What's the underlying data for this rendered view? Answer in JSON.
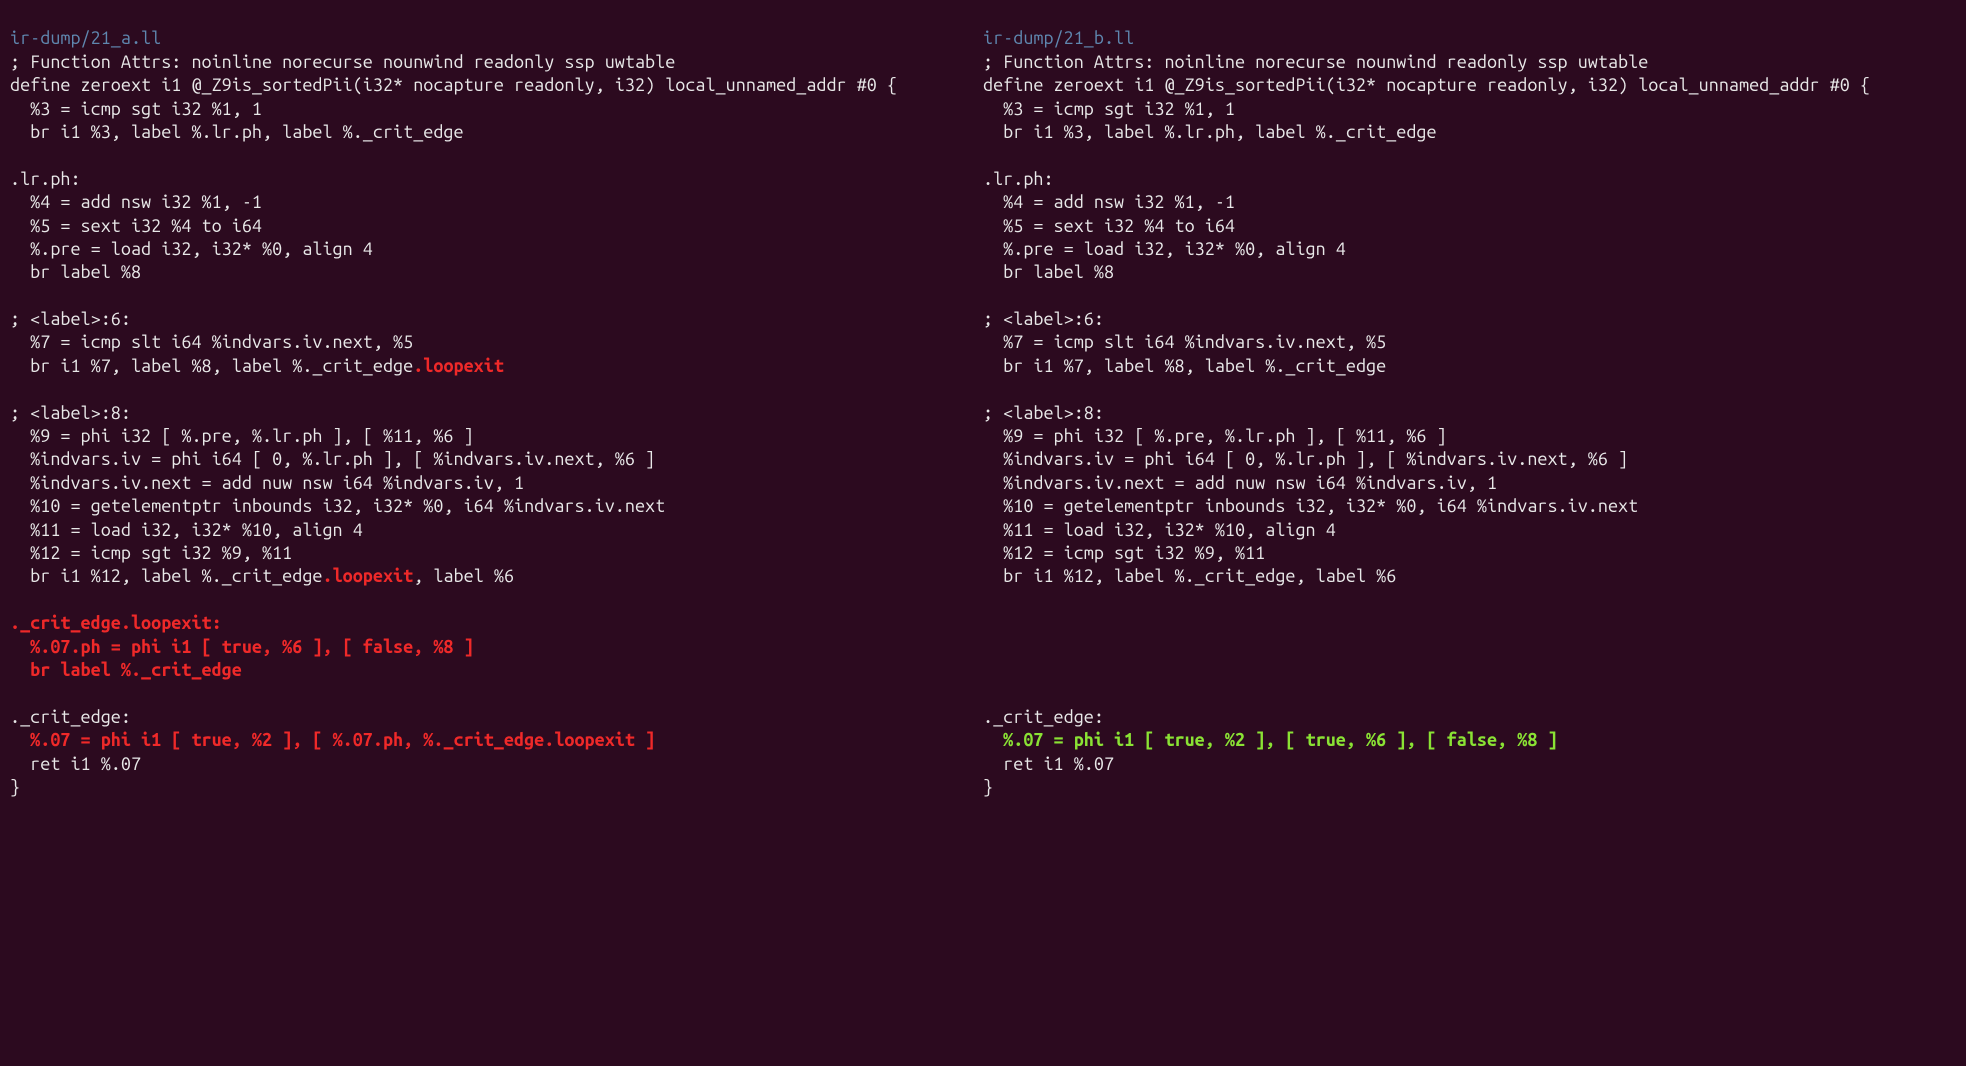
{
  "left": {
    "filename": "ir-dump/21_a.ll",
    "lines": [
      {
        "segments": [
          {
            "t": "; Function Attrs: noinline norecurse nounwind readonly ssp uwtable",
            "c": "plain"
          }
        ]
      },
      {
        "segments": [
          {
            "t": "define zeroext i1 @_Z9is_sortedPii(i32* nocapture readonly, i32) local_unnamed_addr #0 {",
            "c": "plain"
          }
        ]
      },
      {
        "segments": [
          {
            "t": "  %3 = icmp sgt i32 %1, 1",
            "c": "plain"
          }
        ]
      },
      {
        "segments": [
          {
            "t": "  br i1 %3, label %.lr.ph, label %._crit_edge",
            "c": "plain"
          }
        ]
      },
      {
        "segments": [
          {
            "t": "",
            "c": "plain"
          }
        ]
      },
      {
        "segments": [
          {
            "t": ".lr.ph:",
            "c": "plain"
          }
        ]
      },
      {
        "segments": [
          {
            "t": "  %4 = add nsw i32 %1, -1",
            "c": "plain"
          }
        ]
      },
      {
        "segments": [
          {
            "t": "  %5 = sext i32 %4 to i64",
            "c": "plain"
          }
        ]
      },
      {
        "segments": [
          {
            "t": "  %.pre = load i32, i32* %0, align 4",
            "c": "plain"
          }
        ]
      },
      {
        "segments": [
          {
            "t": "  br label %8",
            "c": "plain"
          }
        ]
      },
      {
        "segments": [
          {
            "t": "",
            "c": "plain"
          }
        ]
      },
      {
        "segments": [
          {
            "t": "; <label>:6:",
            "c": "plain"
          }
        ]
      },
      {
        "segments": [
          {
            "t": "  %7 = icmp slt i64 %indvars.iv.next, %5",
            "c": "plain"
          }
        ]
      },
      {
        "segments": [
          {
            "t": "  br i1 %7, label %8, label %._crit_edge",
            "c": "plain"
          },
          {
            "t": ".loopexit",
            "c": "del"
          }
        ]
      },
      {
        "segments": [
          {
            "t": "",
            "c": "plain"
          }
        ]
      },
      {
        "segments": [
          {
            "t": "; <label>:8:",
            "c": "plain"
          }
        ]
      },
      {
        "segments": [
          {
            "t": "  %9 = phi i32 [ %.pre, %.lr.ph ], [ %11, %6 ]",
            "c": "plain"
          }
        ]
      },
      {
        "segments": [
          {
            "t": "  %indvars.iv = phi i64 [ 0, %.lr.ph ], [ %indvars.iv.next, %6 ]",
            "c": "plain"
          }
        ]
      },
      {
        "segments": [
          {
            "t": "  %indvars.iv.next = add nuw nsw i64 %indvars.iv, 1",
            "c": "plain"
          }
        ]
      },
      {
        "segments": [
          {
            "t": "  %10 = getelementptr inbounds i32, i32* %0, i64 %indvars.iv.next",
            "c": "plain"
          }
        ]
      },
      {
        "segments": [
          {
            "t": "  %11 = load i32, i32* %10, align 4",
            "c": "plain"
          }
        ]
      },
      {
        "segments": [
          {
            "t": "  %12 = icmp sgt i32 %9, %11",
            "c": "plain"
          }
        ]
      },
      {
        "segments": [
          {
            "t": "  br i1 %12, label %._crit_edge",
            "c": "plain"
          },
          {
            "t": ".loopexit",
            "c": "del"
          },
          {
            "t": ", label %6",
            "c": "plain"
          }
        ]
      },
      {
        "segments": [
          {
            "t": "",
            "c": "plain"
          }
        ]
      },
      {
        "segments": [
          {
            "t": "._crit_edge.loopexit:",
            "c": "del"
          }
        ]
      },
      {
        "segments": [
          {
            "t": "  %.07.ph = phi i1 [ true, %6 ], [ false, %8 ]",
            "c": "del"
          }
        ]
      },
      {
        "segments": [
          {
            "t": "  br label %._crit_edge",
            "c": "del"
          }
        ]
      },
      {
        "segments": [
          {
            "t": "",
            "c": "plain"
          }
        ]
      },
      {
        "segments": [
          {
            "t": "._crit_edge:",
            "c": "plain"
          }
        ]
      },
      {
        "segments": [
          {
            "t": "  %.07 = phi i1 [ true, %2 ], [ ",
            "c": "del"
          },
          {
            "t": "%.07.ph, %._crit_edge.loopexit",
            "c": "del"
          },
          {
            "t": " ]",
            "c": "del"
          }
        ]
      },
      {
        "segments": [
          {
            "t": "  ret i1 %.07",
            "c": "plain"
          }
        ]
      },
      {
        "segments": [
          {
            "t": "}",
            "c": "plain"
          }
        ]
      }
    ]
  },
  "right": {
    "filename": "ir-dump/21_b.ll",
    "lines": [
      {
        "segments": [
          {
            "t": "; Function Attrs: noinline norecurse nounwind readonly ssp uwtable",
            "c": "plain"
          }
        ]
      },
      {
        "segments": [
          {
            "t": "define zeroext i1 @_Z9is_sortedPii(i32* nocapture readonly, i32) local_unnamed_addr #0 {",
            "c": "plain"
          }
        ]
      },
      {
        "segments": [
          {
            "t": "  %3 = icmp sgt i32 %1, 1",
            "c": "plain"
          }
        ]
      },
      {
        "segments": [
          {
            "t": "  br i1 %3, label %.lr.ph, label %._crit_edge",
            "c": "plain"
          }
        ]
      },
      {
        "segments": [
          {
            "t": "",
            "c": "plain"
          }
        ]
      },
      {
        "segments": [
          {
            "t": ".lr.ph:",
            "c": "plain"
          }
        ]
      },
      {
        "segments": [
          {
            "t": "  %4 = add nsw i32 %1, -1",
            "c": "plain"
          }
        ]
      },
      {
        "segments": [
          {
            "t": "  %5 = sext i32 %4 to i64",
            "c": "plain"
          }
        ]
      },
      {
        "segments": [
          {
            "t": "  %.pre = load i32, i32* %0, align 4",
            "c": "plain"
          }
        ]
      },
      {
        "segments": [
          {
            "t": "  br label %8",
            "c": "plain"
          }
        ]
      },
      {
        "segments": [
          {
            "t": "",
            "c": "plain"
          }
        ]
      },
      {
        "segments": [
          {
            "t": "; <label>:6:",
            "c": "plain"
          }
        ]
      },
      {
        "segments": [
          {
            "t": "  %7 = icmp slt i64 %indvars.iv.next, %5",
            "c": "plain"
          }
        ]
      },
      {
        "segments": [
          {
            "t": "  br i1 %7, label %8, label %._crit_edge",
            "c": "plain"
          }
        ]
      },
      {
        "segments": [
          {
            "t": "",
            "c": "plain"
          }
        ]
      },
      {
        "segments": [
          {
            "t": "; <label>:8:",
            "c": "plain"
          }
        ]
      },
      {
        "segments": [
          {
            "t": "  %9 = phi i32 [ %.pre, %.lr.ph ], [ %11, %6 ]",
            "c": "plain"
          }
        ]
      },
      {
        "segments": [
          {
            "t": "  %indvars.iv = phi i64 [ 0, %.lr.ph ], [ %indvars.iv.next, %6 ]",
            "c": "plain"
          }
        ]
      },
      {
        "segments": [
          {
            "t": "  %indvars.iv.next = add nuw nsw i64 %indvars.iv, 1",
            "c": "plain"
          }
        ]
      },
      {
        "segments": [
          {
            "t": "  %10 = getelementptr inbounds i32, i32* %0, i64 %indvars.iv.next",
            "c": "plain"
          }
        ]
      },
      {
        "segments": [
          {
            "t": "  %11 = load i32, i32* %10, align 4",
            "c": "plain"
          }
        ]
      },
      {
        "segments": [
          {
            "t": "  %12 = icmp sgt i32 %9, %11",
            "c": "plain"
          }
        ]
      },
      {
        "segments": [
          {
            "t": "  br i1 %12, label %._crit_edge, label %6",
            "c": "plain"
          }
        ]
      },
      {
        "segments": [
          {
            "t": "",
            "c": "plain"
          }
        ]
      },
      {
        "segments": [
          {
            "t": "",
            "c": "plain"
          }
        ]
      },
      {
        "segments": [
          {
            "t": "",
            "c": "plain"
          }
        ]
      },
      {
        "segments": [
          {
            "t": "",
            "c": "plain"
          }
        ]
      },
      {
        "segments": [
          {
            "t": "",
            "c": "plain"
          }
        ]
      },
      {
        "segments": [
          {
            "t": "._crit_edge:",
            "c": "plain"
          }
        ]
      },
      {
        "segments": [
          {
            "t": "  %.07 = phi i1 [ true, %2 ], [ ",
            "c": "add"
          },
          {
            "t": "true, %6 ], [ false, %8",
            "c": "add"
          },
          {
            "t": " ]",
            "c": "add"
          }
        ]
      },
      {
        "segments": [
          {
            "t": "  ret i1 %.07",
            "c": "plain"
          }
        ]
      },
      {
        "segments": [
          {
            "t": "}",
            "c": "plain"
          }
        ]
      }
    ]
  }
}
